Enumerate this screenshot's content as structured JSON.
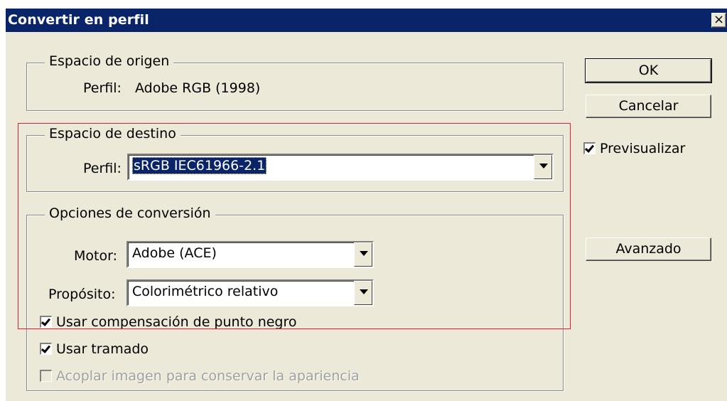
{
  "window": {
    "title": "Convertir en perfil",
    "close_label": "×"
  },
  "source": {
    "legend": "Espacio de origen",
    "profile_label": "Perfil:",
    "profile_value": "Adobe RGB (1998)"
  },
  "destination": {
    "legend": "Espacio de destino",
    "profile_label": "Perfil:",
    "profile_value": "sRGB IEC61966-2.1"
  },
  "options": {
    "legend": "Opciones de conversión",
    "motor_label": "Motor:",
    "motor_value": "Adobe (ACE)",
    "purpose_label": "Propósito:",
    "purpose_value": "Colorimétrico relativo",
    "black_point": {
      "label": "Usar compensación de punto negro",
      "checked": true
    },
    "dither": {
      "label": "Usar tramado",
      "checked": true
    },
    "flatten": {
      "label": "Acoplar imagen para conservar la apariencia",
      "checked": false,
      "disabled": true
    }
  },
  "buttons": {
    "ok": "OK",
    "cancel": "Cancelar",
    "advanced": "Avanzado"
  },
  "preview": {
    "label": "Previsualizar",
    "checked": true
  },
  "colors": {
    "titlebar": "#0a246a",
    "dialog_bg": "#ece9d8",
    "highlight": "#0a246a",
    "annotation": "#e0202a"
  }
}
